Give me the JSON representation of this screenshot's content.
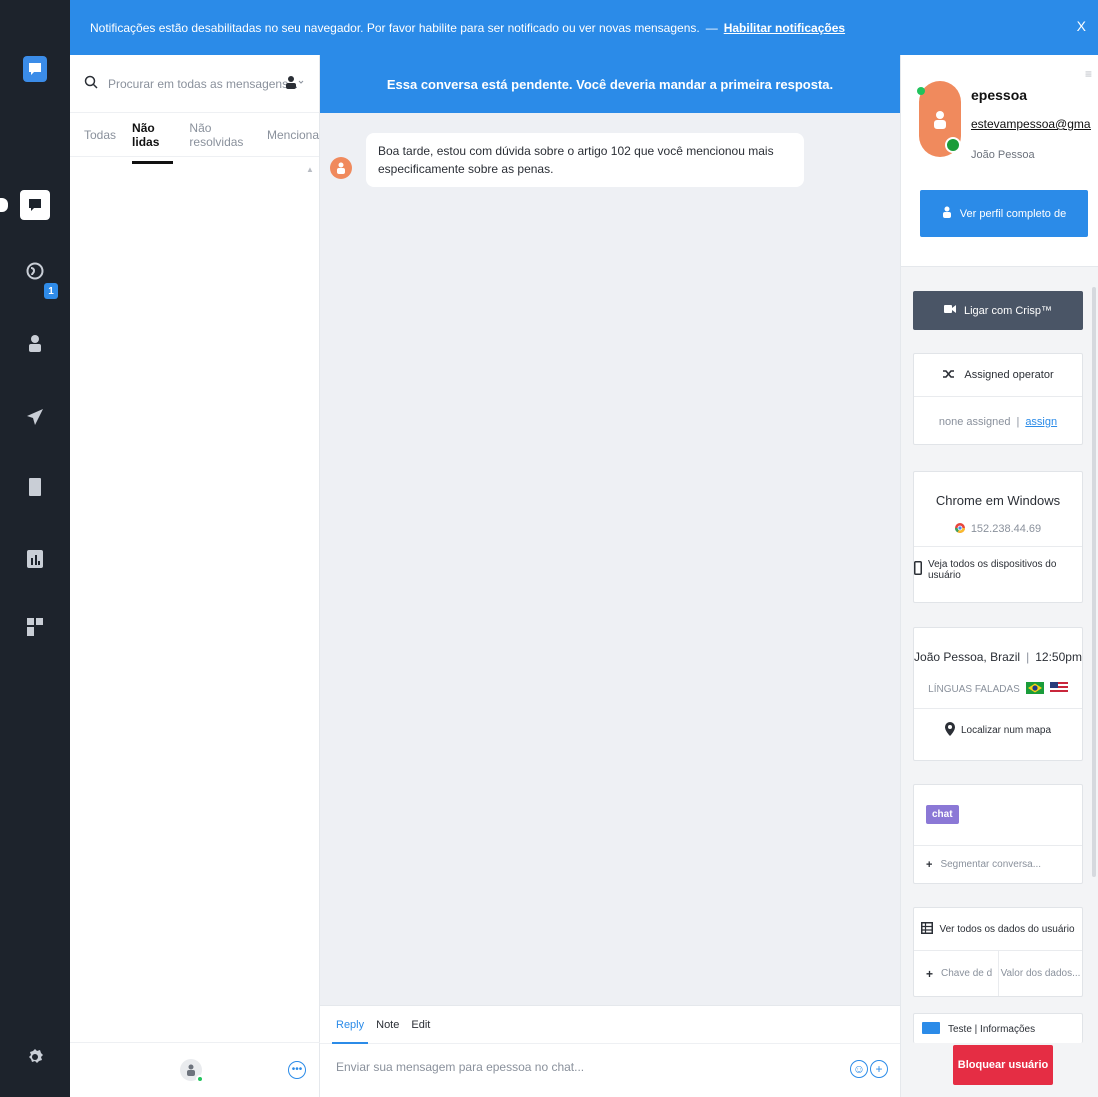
{
  "notification": {
    "text": "Notificações estão desabilitadas no seu navegador. Por favor habilite para ser notificado ou ver novas mensagens.",
    "separator": "—",
    "link": "Habilitar notificações",
    "close": "X"
  },
  "rail": {
    "icons": [
      "chat-logo-icon",
      "inbox-icon",
      "globe-icon",
      "contacts-icon",
      "campaigns-icon",
      "helpdesk-icon",
      "analytics-icon",
      "plugins-icon",
      "settings-icon"
    ],
    "badge": "1"
  },
  "list": {
    "search_placeholder": "Procurar em todas as mensagens...",
    "tabs": [
      "Todas",
      "Não lidas",
      "Não resolvidas",
      "Menciona"
    ],
    "active_tab": "Não lidas"
  },
  "chat": {
    "pending_banner": "Essa conversa está pendente. Você deveria mandar a primeira resposta.",
    "messages": [
      {
        "text": "Boa tarde, estou com dúvida sobre o artigo 102 que você mencionou mais especificamente sobre as penas."
      }
    ],
    "composer": {
      "modes": [
        "Reply",
        "Note",
        "Edit"
      ],
      "active_mode": "Reply",
      "placeholder": "Enviar sua mensagem para epessoa no chat..."
    }
  },
  "profile": {
    "name": "epessoa",
    "email": "estevampessoa@gmail.com",
    "city": "João Pessoa",
    "view_profile": "Ver perfil completo de",
    "call": "Ligar com Crisp™",
    "assigned_title": "Assigned operator",
    "none_assigned": "none assigned",
    "assign_link": "assign",
    "device_title": "Chrome em Windows",
    "ip": "152.238.44.69",
    "devices_link": "Veja todos os dispositivos do usuário",
    "location": "João Pessoa, Brazil",
    "local_time": "12:50pm",
    "languages_label": "LÍNGUAS FALADAS",
    "map_link": "Localizar num mapa",
    "segment_tag": "chat",
    "segment_placeholder": "Segmentar conversa...",
    "data_link": "Ver todos os dados do usuário",
    "key_placeholder": "Chave de d",
    "value_placeholder": "Valor dos dados...",
    "info_card": "Teste | Informações",
    "block": "Bloquear usuário"
  },
  "colors": {
    "brand_blue": "#2b8be8",
    "rail_dark": "#1d232c",
    "block_red": "#e52d44",
    "chat_tag": "#8b78d6"
  }
}
